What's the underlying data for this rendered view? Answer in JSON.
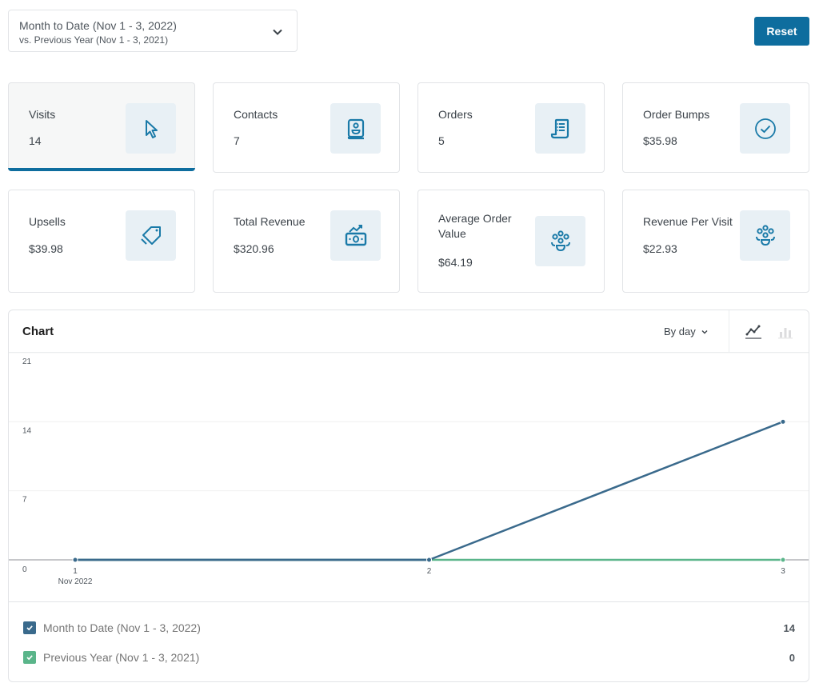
{
  "date_range": {
    "primary": "Month to Date (Nov 1 - 3, 2022)",
    "comparison": "vs. Previous Year (Nov 1 - 3, 2021)"
  },
  "toolbar": {
    "reset_label": "Reset"
  },
  "summary_cards": [
    {
      "label": "Visits",
      "value": "14",
      "icon": "cursor-icon",
      "active": true
    },
    {
      "label": "Contacts",
      "value": "7",
      "icon": "contact-book-icon",
      "active": false
    },
    {
      "label": "Orders",
      "value": "5",
      "icon": "receipt-scroll-icon",
      "active": false
    },
    {
      "label": "Order Bumps",
      "value": "$35.98",
      "icon": "check-circle-icon",
      "active": false
    },
    {
      "label": "Upsells",
      "value": "$39.98",
      "icon": "tags-icon",
      "active": false
    },
    {
      "label": "Total Revenue",
      "value": "$320.96",
      "icon": "money-trend-icon",
      "active": false
    },
    {
      "label": "Average Order Value",
      "value": "$64.19",
      "icon": "people-group-icon",
      "active": false
    },
    {
      "label": "Revenue Per Visit",
      "value": "$22.93",
      "icon": "people-group-icon",
      "active": false
    }
  ],
  "chart_panel": {
    "title": "Chart",
    "interval_label": "By day",
    "chart_types": [
      "line-chart-icon",
      "bar-chart-icon"
    ],
    "active_chart_type": "line"
  },
  "colors": {
    "accent": "#0e6d9e",
    "series_primary": "#3a6a8c",
    "series_comparison": "#5ab58a",
    "icon_bg": "#e8f0f5"
  },
  "chart_data": {
    "type": "line",
    "title": "Chart",
    "xlabel": "",
    "ylabel": "",
    "categories": [
      "1",
      "2",
      "3"
    ],
    "x_sublabel": "Nov 2022",
    "ylim": [
      0,
      21
    ],
    "yticks": [
      "0",
      "7",
      "14",
      "21"
    ],
    "grid": true,
    "legend_placement": "bottom",
    "series": [
      {
        "name": "Month to Date (Nov 1 - 3, 2022)",
        "values": [
          0,
          0,
          14
        ],
        "total": "14",
        "color": "#3a6a8c"
      },
      {
        "name": "Previous Year (Nov 1 - 3, 2021)",
        "values": [
          0,
          0,
          0
        ],
        "total": "0",
        "color": "#5ab58a"
      }
    ]
  }
}
